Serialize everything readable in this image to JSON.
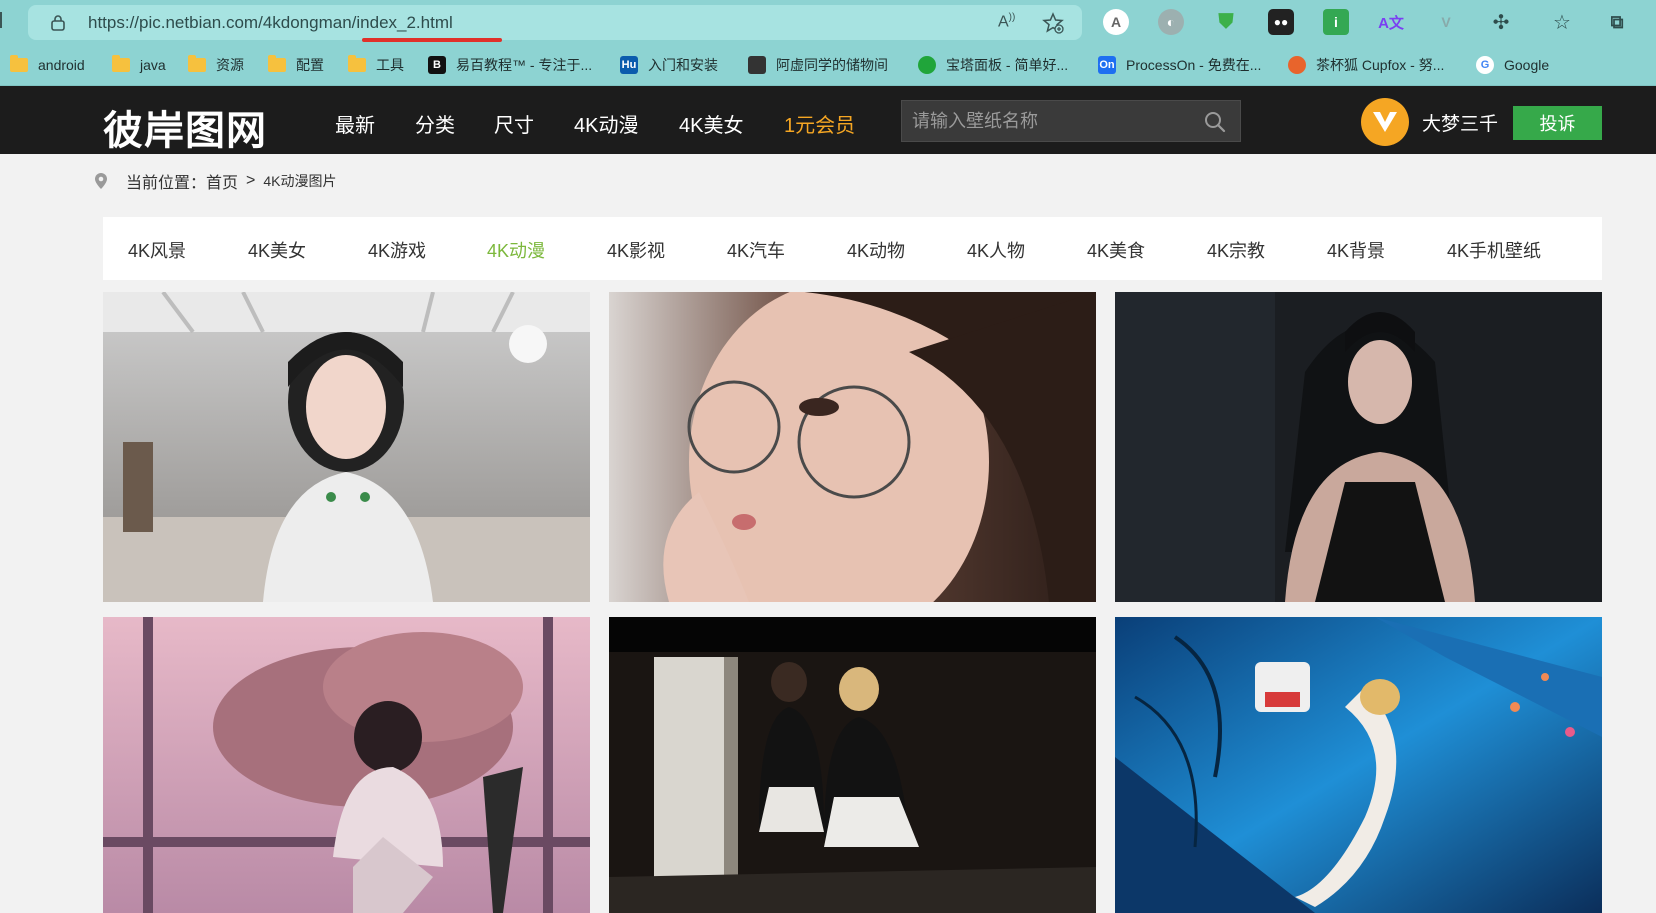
{
  "browser": {
    "url": "https://pic.netbian.com/4kdongman/index_2.html",
    "bookmarks": [
      {
        "label": "android",
        "type": "folder"
      },
      {
        "label": "java",
        "type": "folder"
      },
      {
        "label": "资源",
        "type": "folder"
      },
      {
        "label": "配置",
        "type": "folder"
      },
      {
        "label": "工具",
        "type": "folder"
      },
      {
        "label": "易百教程™ - 专注于...",
        "type": "site",
        "icon": "B"
      },
      {
        "label": "入门和安装",
        "type": "site",
        "icon": "Hu"
      },
      {
        "label": "阿虚同学的储物间",
        "type": "site",
        "icon": ""
      },
      {
        "label": "宝塔面板 - 简单好...",
        "type": "site",
        "icon": ""
      },
      {
        "label": "ProcessOn - 免费在...",
        "type": "site",
        "icon": "On"
      },
      {
        "label": "茶杯狐 Cupfox - 努...",
        "type": "site",
        "icon": ""
      },
      {
        "label": "Google",
        "type": "site",
        "icon": "G"
      }
    ]
  },
  "site": {
    "logo": "彼岸图网",
    "nav": [
      "最新",
      "分类",
      "尺寸",
      "4K动漫",
      "4K美女",
      "1元会员"
    ],
    "search_placeholder": "请输入壁纸名称",
    "username": "大梦三千",
    "complaint_label": "投诉"
  },
  "breadcrumb": {
    "prefix": "当前位置：",
    "home": "首页",
    "separator": ">",
    "current": "4K动漫图片"
  },
  "categories": {
    "items": [
      "4K风景",
      "4K美女",
      "4K游戏",
      "4K动漫",
      "4K影视",
      "4K汽车",
      "4K动物",
      "4K人物",
      "4K美食",
      "4K宗教",
      "4K背景",
      "4K手机壁纸"
    ],
    "active": "4K动漫"
  },
  "thumbnails": [
    {
      "alt": "anime-girl-white-shirt-room"
    },
    {
      "alt": "girl-with-glasses-closeup"
    },
    {
      "alt": "girl-black-dress-dark"
    },
    {
      "alt": "girl-sitting-pink-sky"
    },
    {
      "alt": "two-maids-dark-room"
    },
    {
      "alt": "girl-lying-blue-neon"
    }
  ],
  "colors": {
    "browser_chrome": "#8dd3d2",
    "header_bg": "#1c1c1c",
    "vip_orange": "#f5a623",
    "active_green": "#7cb83c",
    "button_green": "#36a94a"
  }
}
